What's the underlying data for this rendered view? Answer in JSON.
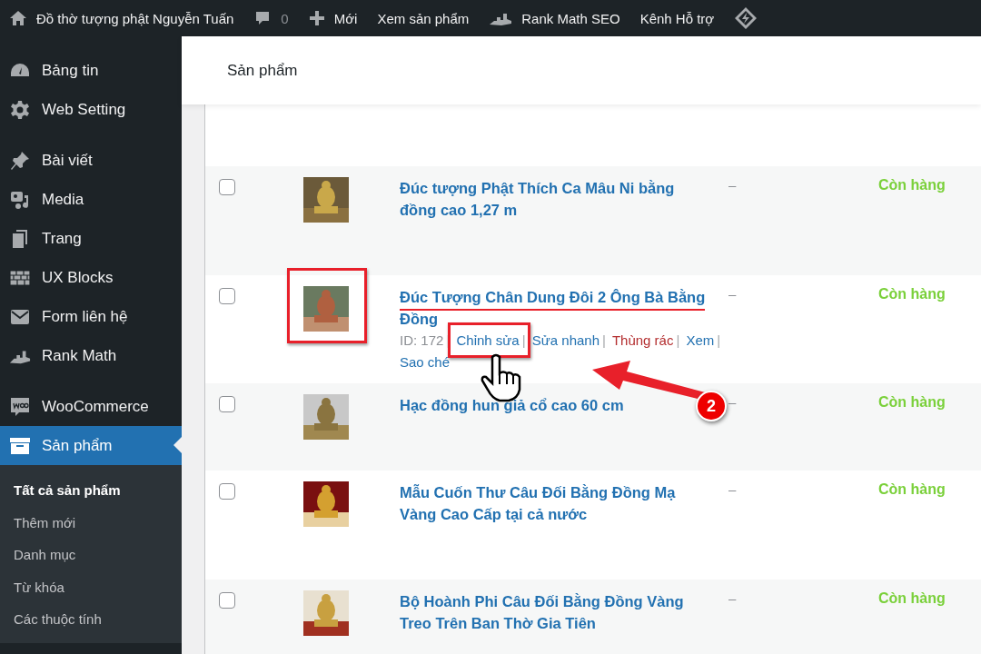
{
  "admin_bar": {
    "site_name": "Đồ thờ tượng phật Nguyễn Tuấn",
    "comments": "0",
    "new": "Mới",
    "view": "Xem sản phẩm",
    "seo": "Rank Math SEO",
    "support": "Kênh Hỗ trợ"
  },
  "sidebar": {
    "groups": [
      [
        {
          "label": "Bảng tin",
          "selected": false
        },
        {
          "label": "Web Setting",
          "selected": false
        }
      ],
      [
        {
          "label": "Bài viết",
          "selected": false
        },
        {
          "label": "Media",
          "selected": false
        },
        {
          "label": "Trang",
          "selected": false
        },
        {
          "label": "UX Blocks",
          "selected": false
        },
        {
          "label": "Form liên hệ",
          "selected": false
        },
        {
          "label": "Rank Math",
          "selected": false
        }
      ],
      [
        {
          "label": "WooCommerce",
          "selected": false
        },
        {
          "label": "Sản phẩm",
          "selected": true
        }
      ]
    ],
    "submenu": [
      {
        "label": "Tất cả sản phẩm",
        "selected": true
      },
      {
        "label": "Thêm mới",
        "selected": false
      },
      {
        "label": "Danh mục",
        "selected": false
      },
      {
        "label": "Từ khóa",
        "selected": false
      },
      {
        "label": "Các thuộc tính",
        "selected": false
      }
    ]
  },
  "page_title": "Sản phẩm",
  "rows": [
    {
      "title": "Đúc tượng Phật Thích Ca Mâu Ni bằng đồng cao 1,27 m",
      "sku": "–",
      "stock": "Còn hàng",
      "checked": false,
      "annotated": false
    },
    {
      "title": "Đúc Tượng Chân Dung Đôi 2 Ông Bà Bằng Đồng",
      "sku": "–",
      "stock": "Còn hàng",
      "checked": false,
      "annotated": true,
      "action_separator": "|",
      "actions": [
        {
          "kind": "id",
          "text": "ID: 172"
        },
        {
          "kind": "link",
          "text": "Chỉnh sửa"
        },
        {
          "kind": "link",
          "text": "Sửa nhanh"
        },
        {
          "kind": "delete",
          "text": "Thùng rác"
        },
        {
          "kind": "link",
          "text": "Xem"
        },
        {
          "kind": "link",
          "text": "Sao ché"
        }
      ]
    },
    {
      "title": "Hạc đồng hun giả cổ cao 60 cm",
      "sku": "–",
      "stock": "Còn hàng",
      "checked": false,
      "annotated": false
    },
    {
      "title": "Mẫu Cuốn Thư Câu Đối Bằng Đồng Mạ Vàng Cao Cấp tại cả nước",
      "sku": "–",
      "stock": "Còn hàng",
      "checked": false,
      "annotated": false
    },
    {
      "title": "Bộ Hoành Phi Câu Đối Bằng Đồng Vàng Treo Trên Ban Thờ Gia Tiên",
      "sku": "–",
      "stock": "Còn hàng",
      "checked": false,
      "annotated": false
    }
  ],
  "annotation": {
    "badge": "2"
  }
}
